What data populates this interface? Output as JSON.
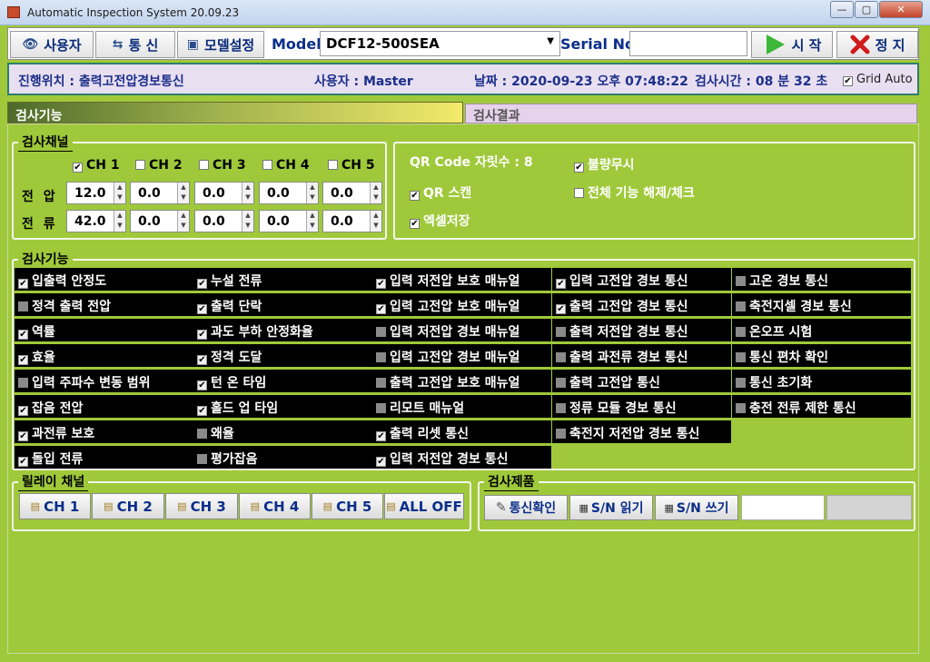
{
  "window": {
    "title": "Automatic Inspection System 20.09.23",
    "min": "—",
    "max": "▢",
    "close": "✕"
  },
  "toolbar": {
    "user_btn": "사용자",
    "comm_btn": "통  신",
    "model_btn": "모델설정",
    "model_label": "Model",
    "model_value": "DCF12-500SEA",
    "serial_label": "Serial No",
    "serial_value": "",
    "start_btn": "시  작",
    "stop_btn": "정  지"
  },
  "status": {
    "progress": "진행위치 : 출력고전압경보통신",
    "user": "사용자 : Master",
    "date": "날짜 : 2020-09-23 오후 07:48:22",
    "elapsed": "검사시간 : 08 분 32 초",
    "grid_auto": "Grid Auto",
    "grid_auto_checked": true
  },
  "tabs": {
    "func": "검사기능",
    "result": "검사결과"
  },
  "channel_group": {
    "title": "검사채널",
    "channels": [
      {
        "label": "CH 1",
        "checked": true
      },
      {
        "label": "CH 2",
        "checked": false
      },
      {
        "label": "CH 3",
        "checked": false
      },
      {
        "label": "CH 4",
        "checked": false
      },
      {
        "label": "CH 5",
        "checked": false
      }
    ],
    "voltage_label": "전 압",
    "current_label": "전 류",
    "voltage": [
      "12.0",
      "0.0",
      "0.0",
      "0.0",
      "0.0"
    ],
    "current": [
      "42.0",
      "0.0",
      "0.0",
      "0.0",
      "0.0"
    ]
  },
  "options": {
    "qr_digits": "QR Code 자릿수 : 8",
    "qr_scan": "QR 스캔",
    "qr_scan_checked": true,
    "excel_save": "엑셀저장",
    "excel_save_checked": true,
    "ignore_defect": "불량무시",
    "ignore_defect_checked": true,
    "toggle_all": "전체 기능 해제/체크",
    "toggle_all_checked": false
  },
  "func_group": {
    "title": "검사기능",
    "columns": [
      [
        {
          "label": "입출력 안정도",
          "checked": true
        },
        {
          "label": "정격 출력 전압",
          "checked": false
        },
        {
          "label": "역률",
          "checked": true
        },
        {
          "label": "효율",
          "checked": true
        },
        {
          "label": "입력 주파수 변동 범위",
          "checked": false
        },
        {
          "label": "잡음 전압",
          "checked": true
        },
        {
          "label": "과전류 보호",
          "checked": true
        },
        {
          "label": "돌입 전류",
          "checked": true
        }
      ],
      [
        {
          "label": "누설 전류",
          "checked": true
        },
        {
          "label": "출력 단락",
          "checked": true
        },
        {
          "label": "과도 부하 안정화율",
          "checked": true
        },
        {
          "label": "정격 도달",
          "checked": true
        },
        {
          "label": "턴 온 타임",
          "checked": true
        },
        {
          "label": "홀드 업 타임",
          "checked": true
        },
        {
          "label": "왜율",
          "checked": false
        },
        {
          "label": "평가잡음",
          "checked": false
        }
      ],
      [
        {
          "label": "입력 저전압 보호 매뉴얼",
          "checked": true
        },
        {
          "label": "입력 고전압 보호 매뉴얼",
          "checked": true
        },
        {
          "label": "입력 저전압 경보 매뉴얼",
          "checked": false
        },
        {
          "label": "입력 고전압 경보 매뉴얼",
          "checked": false
        },
        {
          "label": "출력 고전압 보호 매뉴얼",
          "checked": false
        },
        {
          "label": "리모트 매뉴얼",
          "checked": false
        },
        {
          "label": "출력 리셋 통신",
          "checked": true
        },
        {
          "label": "입력 저전압 경보 통신",
          "checked": true
        }
      ],
      [
        {
          "label": "입력 고전압 경보 통신",
          "checked": true
        },
        {
          "label": "출력 고전압 경보 통신",
          "checked": true
        },
        {
          "label": "출력 저전압 경보 통신",
          "checked": false
        },
        {
          "label": "출력 과전류 경보 통신",
          "checked": false
        },
        {
          "label": "출력 고전압 통신",
          "checked": false
        },
        {
          "label": "정류 모듈 경보 통신",
          "checked": false
        },
        {
          "label": "축전지 저전압 경보 통신",
          "checked": false
        }
      ],
      [
        {
          "label": "고온 경보 통신",
          "checked": false
        },
        {
          "label": "축전지셀 경보 통신",
          "checked": false
        },
        {
          "label": "온오프 시험",
          "checked": false
        },
        {
          "label": "통신 편차 확인",
          "checked": false
        },
        {
          "label": "통신 초기화",
          "checked": false
        },
        {
          "label": "충전 전류 제한 통신",
          "checked": false
        }
      ]
    ]
  },
  "relay_group": {
    "title": "릴레이 채널",
    "buttons": [
      "CH 1",
      "CH 2",
      "CH 3",
      "CH 4",
      "CH 5",
      "ALL OFF"
    ]
  },
  "product_group": {
    "title": "검사제품",
    "comm_check": "통신확인",
    "sn_read": "S/N 읽기",
    "sn_write": "S/N 쓰기",
    "sn_value": ""
  }
}
